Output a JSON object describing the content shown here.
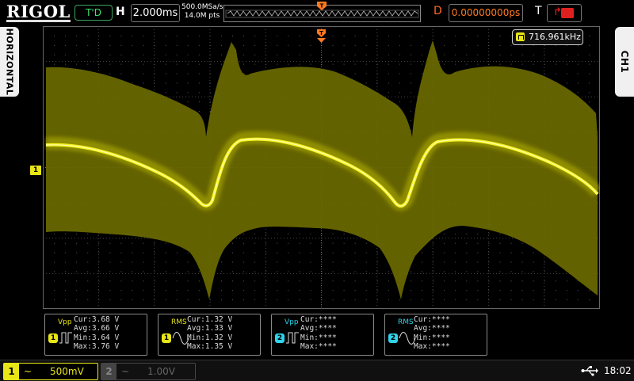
{
  "brand": "RIGOL",
  "run_state": "T'D",
  "horizontal": {
    "label": "H",
    "timebase": "2.000ms",
    "sample_rate": "500.0MSa/s",
    "memory_depth": "14.0M pts"
  },
  "delay": {
    "label": "D",
    "value": "0.00000000ps"
  },
  "trigger": {
    "label": "T",
    "slope_icon": "rising-edge-icon",
    "source_color": "#e02020"
  },
  "side_tabs": {
    "left": "HORIZONTAL",
    "right": "CH1"
  },
  "channel_marker": "1",
  "frequency_readout": "716.961kHz",
  "colors": {
    "ch1": "#e8e616",
    "ch2": "#2fd3ea",
    "envelope": "#6b6a00"
  },
  "measurements": [
    {
      "name": "Vpp",
      "channel": "1",
      "rows": [
        {
          "label": "Cur:",
          "value": "3.68 V"
        },
        {
          "label": "Avg:",
          "value": "3.66 V"
        },
        {
          "label": "Min:",
          "value": "3.64 V"
        },
        {
          "label": "Max:",
          "value": "3.76 V"
        }
      ]
    },
    {
      "name": "RMS",
      "channel": "1",
      "rows": [
        {
          "label": "Cur:",
          "value": "1.32 V"
        },
        {
          "label": "Avg:",
          "value": "1.33 V"
        },
        {
          "label": "Min:",
          "value": "1.32 V"
        },
        {
          "label": "Max:",
          "value": "1.35 V"
        }
      ]
    },
    {
      "name": "Vpp",
      "channel": "2",
      "rows": [
        {
          "label": "Cur:",
          "value": "****"
        },
        {
          "label": "Avg:",
          "value": "****"
        },
        {
          "label": "Min:",
          "value": "****"
        },
        {
          "label": "Max:",
          "value": "****"
        }
      ]
    },
    {
      "name": "RMS",
      "channel": "2",
      "rows": [
        {
          "label": "Cur:",
          "value": "****"
        },
        {
          "label": "Avg:",
          "value": "****"
        },
        {
          "label": "Min:",
          "value": "****"
        },
        {
          "label": "Max:",
          "value": "****"
        }
      ]
    }
  ],
  "channels": [
    {
      "number": "1",
      "coupling": "~",
      "scale": "500mV"
    },
    {
      "number": "2",
      "coupling": "~",
      "scale": "1.00V"
    }
  ],
  "status": {
    "usb_icon": "usb-icon",
    "time": "18:02"
  }
}
